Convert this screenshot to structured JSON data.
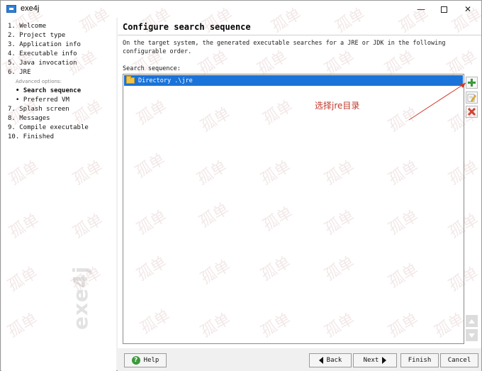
{
  "window": {
    "title": "exe4j",
    "minimize_label": "—",
    "close_label": "✕"
  },
  "sidebar": {
    "items": [
      {
        "label": "1. Welcome"
      },
      {
        "label": "2. Project type"
      },
      {
        "label": "3. Application info"
      },
      {
        "label": "4. Executable info"
      },
      {
        "label": "5. Java invocation"
      },
      {
        "label": "6. JRE"
      }
    ],
    "advanced_caption": "Advanced options:",
    "sub_items": [
      {
        "label": "• Search sequence",
        "active": true
      },
      {
        "label": "• Preferred VM",
        "active": false
      }
    ],
    "items_after": [
      {
        "label": "7. Splash screen"
      },
      {
        "label": "8. Messages"
      },
      {
        "label": "9. Compile executable"
      },
      {
        "label": "10. Finished"
      }
    ],
    "brand_watermark": "exe4j"
  },
  "main": {
    "title": "Configure search sequence",
    "description": "On the target system, the generated executable searches for a JRE or JDK in the following configurable order.",
    "list_label": "Search sequence:",
    "entries": [
      {
        "text": "Directory .\\jre",
        "icon": "folder-icon",
        "selected": true
      }
    ],
    "annotation": "选择jre目录",
    "watermark_text": "孤单"
  },
  "side_buttons": {
    "add_icon": "plus-icon",
    "edit_icon": "edit-icon",
    "remove_icon": "delete-icon",
    "up_icon": "arrow-up-icon",
    "down_icon": "arrow-down-icon"
  },
  "footer": {
    "help_label": "Help",
    "back_label": "Back",
    "next_label": "Next",
    "finish_label": "Finish",
    "cancel_label": "Cancel"
  },
  "colors": {
    "selection": "#1a73d9",
    "annotation": "#c0392b",
    "add_green": "#3a9a3a",
    "delete_red": "#d03a2a"
  }
}
